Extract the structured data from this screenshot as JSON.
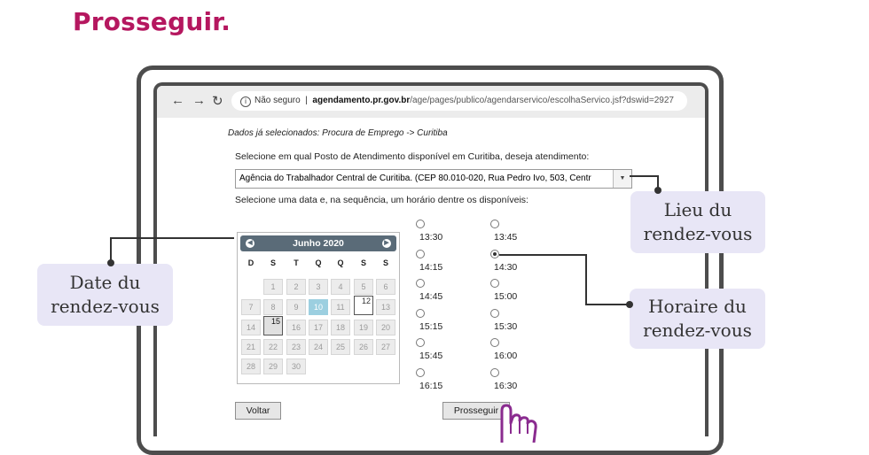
{
  "heading": "Prosseguir.",
  "browser": {
    "back_icon": "arrow-left",
    "forward_icon": "arrow-right",
    "reload_icon": "reload",
    "security_label": "Não seguro",
    "url_host": "agendamento.pr.gov.br",
    "url_path": "/age/pages/publico/agendarservico/escolhaServico.jsf?dswid=2927"
  },
  "form": {
    "selected_data": "Dados já selecionados: Procura de Emprego -> Curitiba",
    "posto_prompt": "Selecione em qual Posto de Atendimento disponível em Curitiba, deseja atendimento:",
    "posto_value": "Agência do Trabalhador Central de Curitiba. (CEP 80.010-020, Rua Pedro Ivo, 503, Centr",
    "date_prompt": "Selecione uma data e, na sequência, um horário dentre os disponíveis:"
  },
  "calendar": {
    "month": "Junho 2020",
    "weekdays": [
      "D",
      "S",
      "T",
      "Q",
      "Q",
      "S",
      "S"
    ],
    "days": [
      "1",
      "2",
      "3",
      "4",
      "5",
      "6",
      "7",
      "8",
      "9",
      "10",
      "11",
      "12",
      "13",
      "14",
      "15",
      "16",
      "17",
      "18",
      "19",
      "20",
      "21",
      "22",
      "23",
      "24",
      "25",
      "26",
      "27",
      "28",
      "29",
      "30"
    ],
    "selected_day": "10",
    "today_day": "12",
    "current_day": "15"
  },
  "times": [
    "13:30",
    "13:45",
    "14:15",
    "14:30",
    "14:45",
    "15:00",
    "15:15",
    "15:30",
    "15:45",
    "16:00",
    "16:15",
    "16:30"
  ],
  "selected_time": "14:30",
  "buttons": {
    "back": "Voltar",
    "next": "Prosseguir"
  },
  "callouts": {
    "location": [
      "Lieu du",
      "rendez-vous"
    ],
    "date": [
      "Date du",
      "rendez-vous"
    ],
    "time": [
      "Horaire du",
      "rendez-vous"
    ]
  },
  "colors": {
    "heading": "#b5175f",
    "callout_bg": "#e8e6f6",
    "calendar_header": "#5a6b78",
    "selected_day": "#9ccfe0",
    "cursor": "#8a2b8f"
  }
}
